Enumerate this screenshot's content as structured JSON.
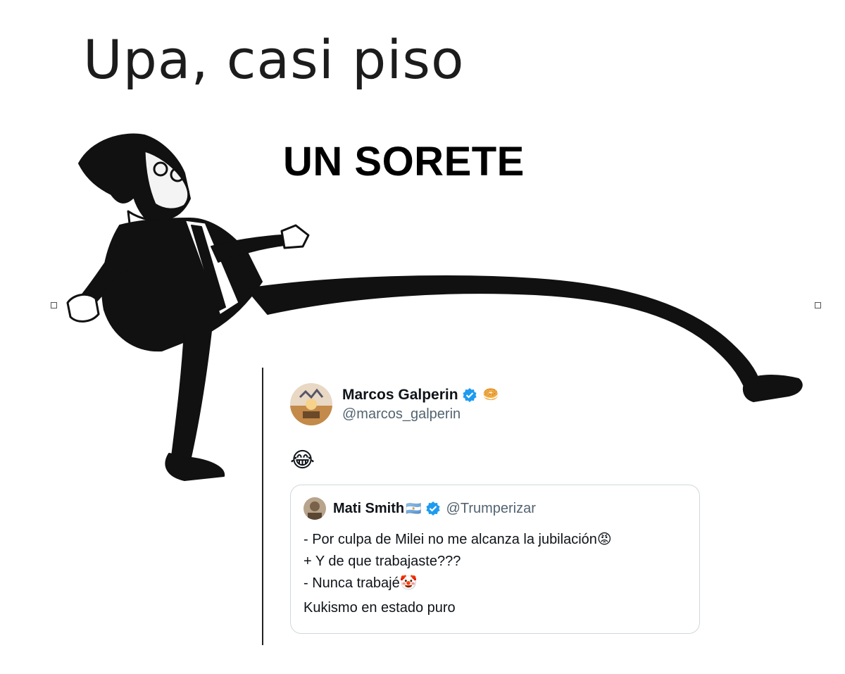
{
  "meme": {
    "title": "Upa, casi piso",
    "caption": "UN SORETE"
  },
  "tweet": {
    "display_name": "Marcos Galperin",
    "handle": "@marcos_galperin",
    "badge_icon": "verified-badge-icon",
    "affiliate_emoji": "🥯",
    "body_emoji": "😂"
  },
  "quoted_tweet": {
    "display_name": "Mati Smith",
    "flag": "🇦🇷",
    "handle": "@Trumperizar",
    "lines": [
      "- Por culpa de Milei no me alcanza la jubilación😡",
      "+ Y de que trabajaste???",
      "- Nunca trabajé🤡"
    ],
    "footer": "Kukismo en estado puro"
  },
  "colors": {
    "verified_blue": "#1d9bf0",
    "secondary_text": "#536471",
    "border": "#cfd9de"
  }
}
